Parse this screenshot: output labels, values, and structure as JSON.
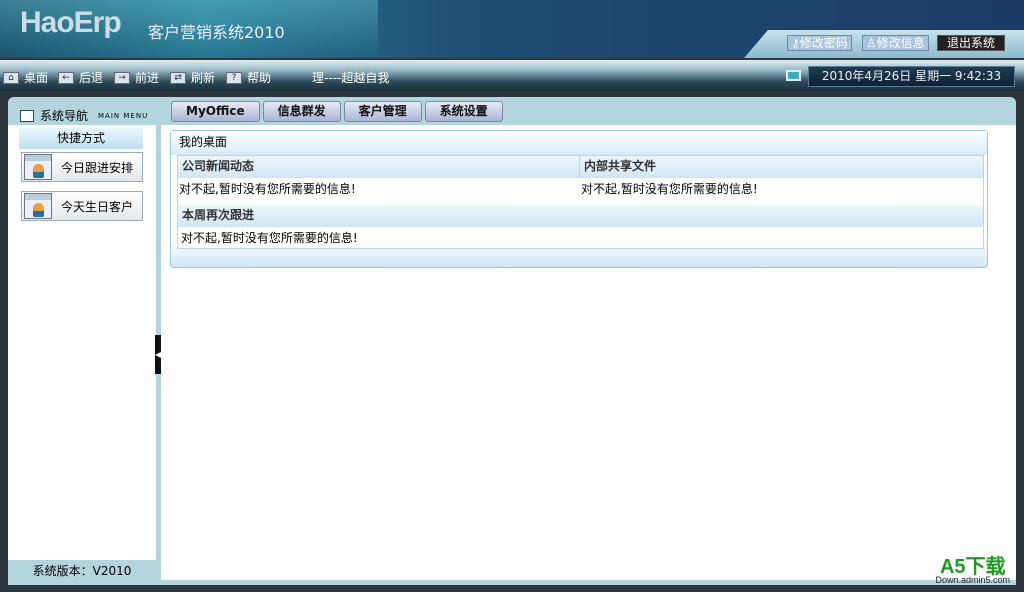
{
  "header": {
    "logo": "HaoErp",
    "subtitle": "客户营销系统2010",
    "change_password": "修改密码",
    "change_info": "修改信息",
    "logout": "退出系统"
  },
  "toolbar": {
    "items": [
      {
        "label": "桌面",
        "icon": "home-icon"
      },
      {
        "label": "后退",
        "icon": "arrow-left-icon"
      },
      {
        "label": "前进",
        "icon": "arrow-right-icon"
      },
      {
        "label": "刷新",
        "icon": "refresh-icon"
      },
      {
        "label": "帮助",
        "icon": "help-icon"
      }
    ],
    "marquee": "理----超越自我",
    "datetime": "2010年4月26日 星期一 9:42:33"
  },
  "sidebar": {
    "title": "系统导航",
    "title_en": "MAIN MENU",
    "section": "快捷方式",
    "items": [
      "今日跟进安排",
      "今天生日客户"
    ],
    "version": "系统版本：V2010"
  },
  "tabs": [
    "MyOffice",
    "信息群发",
    "客户管理",
    "系统设置"
  ],
  "desktop": {
    "title": "我的桌面",
    "news_header": "公司新闻动态",
    "news_text": "对不起,暂时没有您所需要的信息!",
    "files_header": "内部共享文件",
    "files_text": "对不起,暂时没有您所需要的信息!",
    "followup_header": "本周再次跟进",
    "followup_text": "对不起,暂时没有您所需要的信息!"
  },
  "watermark": {
    "brand": "A5下载",
    "url": "Down.admin5.com"
  }
}
